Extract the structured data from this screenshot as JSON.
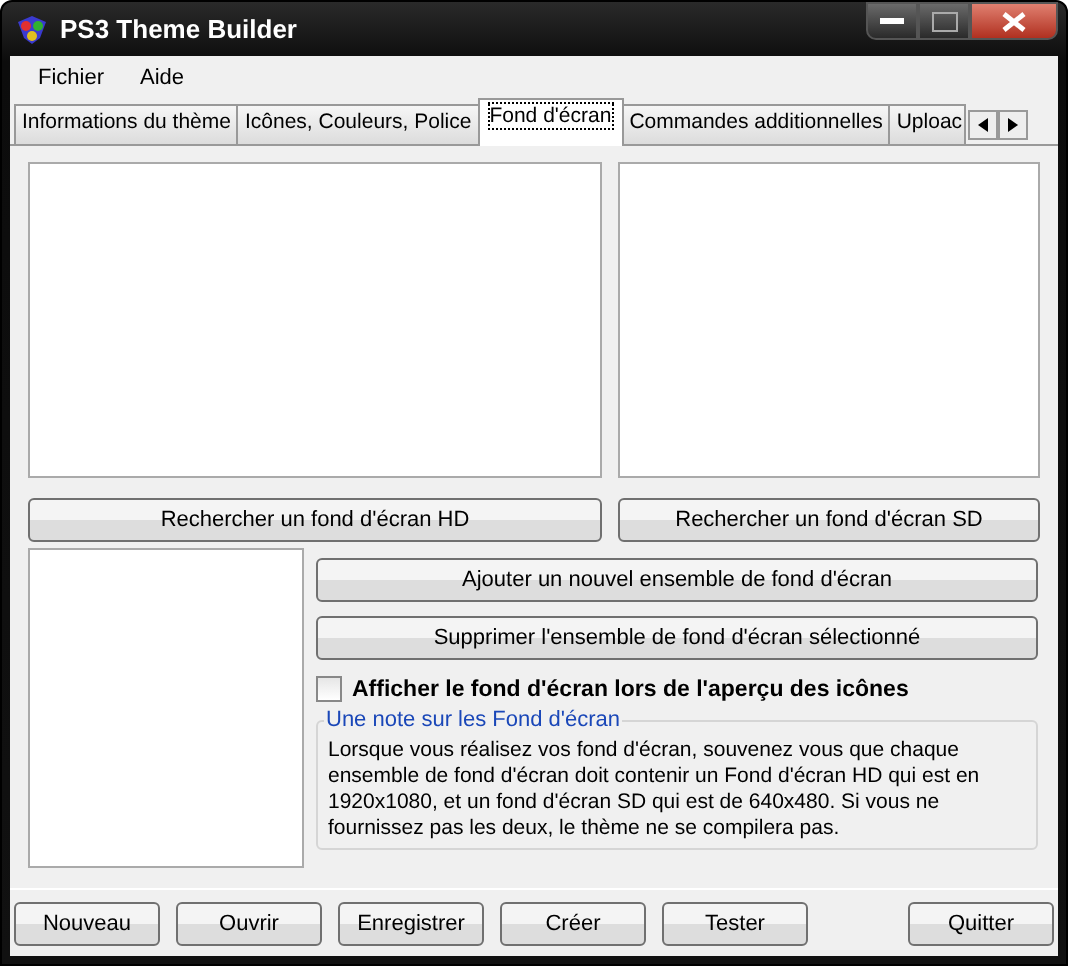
{
  "window": {
    "title": "PS3 Theme Builder"
  },
  "menu": [
    "Fichier",
    "Aide"
  ],
  "tabs": [
    {
      "label": "Informations du thème",
      "selected": false
    },
    {
      "label": "Icônes, Couleurs, Police",
      "selected": false
    },
    {
      "label": "Fond d'écran",
      "selected": true
    },
    {
      "label": "Commandes additionnelles",
      "selected": false
    },
    {
      "label": "Uploac",
      "selected": false
    }
  ],
  "hd_button": "Rechercher un fond d'écran HD",
  "sd_button": "Rechercher un fond d'écran SD",
  "add_button": "Ajouter un nouvel ensemble de fond d'écran",
  "remove_button": "Supprimer l'ensemble de fond d'écran sélectionné",
  "show_checkbox": {
    "label": "Afficher le fond d'écran lors de l'aperçu des icônes",
    "checked": false
  },
  "note": {
    "title": "Une note sur les Fond d'écran",
    "text": "Lorsque vous réalisez vos fond d'écran, souvenez vous que chaque ensemble de fond d'écran doit contenir un Fond d'écran HD qui est en 1920x1080, et un fond d'écran SD qui est de 640x480. Si vous ne fournissez pas les deux, le thème ne se compilera pas."
  },
  "bottom_buttons": [
    "Nouveau",
    "Ouvrir",
    "Enregistrer",
    "Créer",
    "Tester",
    "Quitter"
  ]
}
